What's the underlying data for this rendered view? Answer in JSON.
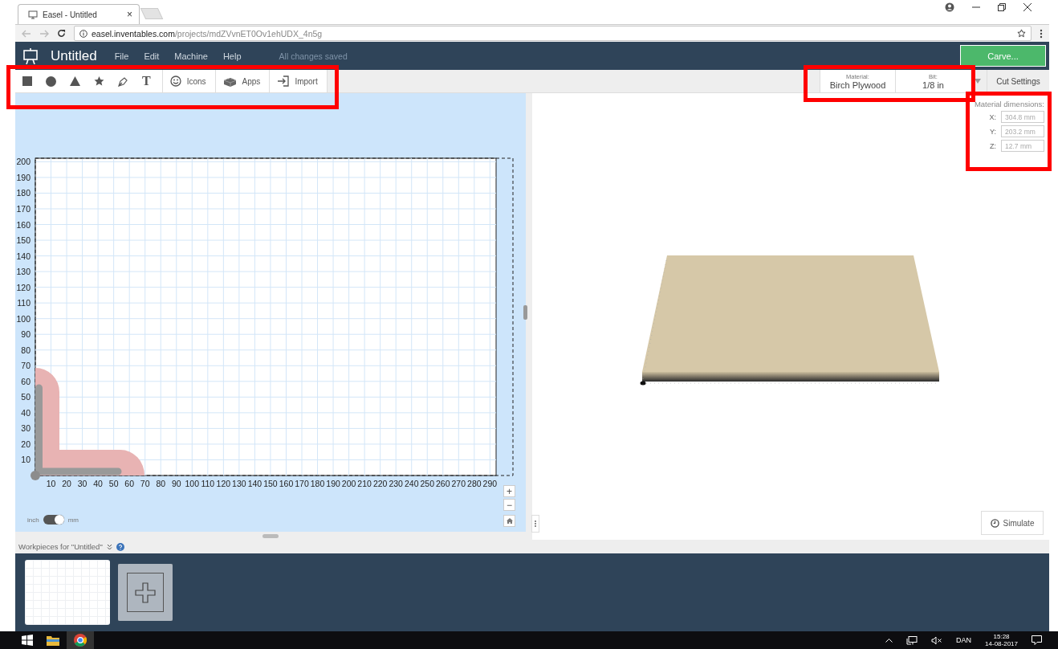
{
  "browser": {
    "tab_title": "Easel - Untitled",
    "tab_close": "×",
    "url_domain": "easel.inventables.com",
    "url_path": "/projects/mdZVvnET0Ov1ehUDX_4n5g"
  },
  "header": {
    "title": "Untitled",
    "menu": [
      "File",
      "Edit",
      "Machine",
      "Help"
    ],
    "save_status": "All changes saved",
    "carve_button": "Carve..."
  },
  "toolbar": {
    "text_tool": "T",
    "tools": [
      {
        "kind": "icons",
        "label": "Icons"
      },
      {
        "kind": "apps",
        "label": "Apps"
      },
      {
        "kind": "import",
        "label": "Import"
      }
    ],
    "material": {
      "label": "Material:",
      "value": "Birch Plywood"
    },
    "bit": {
      "label": "Bit:",
      "value": "1/8 in"
    },
    "cut_settings": "Cut Settings"
  },
  "dimensions": {
    "title": "Material dimensions:",
    "fields": [
      {
        "axis": "X:",
        "placeholder": "304.8 mm"
      },
      {
        "axis": "Y:",
        "placeholder": "203.2 mm"
      },
      {
        "axis": "Z:",
        "placeholder": "12.7 mm"
      }
    ]
  },
  "canvas": {
    "x_labels": [
      "10",
      "20",
      "30",
      "40",
      "50",
      "60",
      "70",
      "80",
      "90",
      "100",
      "110",
      "120",
      "130",
      "140",
      "150",
      "160",
      "170",
      "180",
      "190",
      "200",
      "210",
      "220",
      "230",
      "240",
      "250",
      "260",
      "270",
      "280",
      "290"
    ],
    "y_labels": [
      "200",
      "190",
      "180",
      "170",
      "160",
      "150",
      "140",
      "130",
      "120",
      "110",
      "100",
      "90",
      "80",
      "70",
      "60",
      "50",
      "40",
      "30",
      "20",
      "10"
    ],
    "zoom_in": "+",
    "zoom_out": "−",
    "unit_toggle": {
      "left_label": "inch",
      "right_label": "mm",
      "on": true
    }
  },
  "simulate_button": "Simulate",
  "workpieces": {
    "label": "Workpieces for \"Untitled\""
  },
  "taskbar": {
    "language": "DAN",
    "time": "15:28",
    "date": "14-08-2017"
  }
}
